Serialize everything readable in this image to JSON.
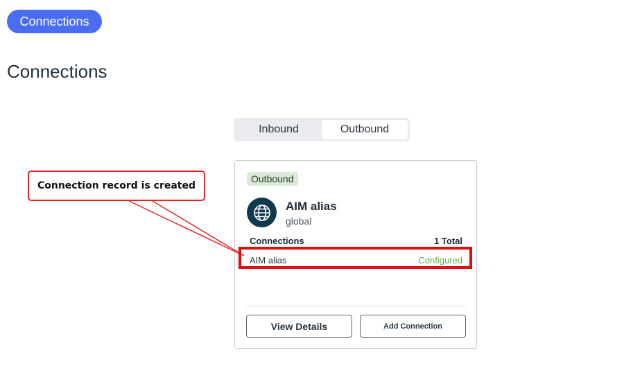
{
  "header": {
    "nav_button_label": "Connections",
    "page_title": "Connections"
  },
  "tabs": [
    {
      "label": "Inbound",
      "active": false
    },
    {
      "label": "Outbound",
      "active": true
    }
  ],
  "card": {
    "badge": "Outbound",
    "icon": "globe-icon",
    "name": "AIM alias",
    "subtitle": "global",
    "connections_heading": "Connections",
    "connections_total": "1 Total",
    "connections": [
      {
        "name": "AIM alias",
        "status": "Configured"
      }
    ],
    "view_details_label": "View Details",
    "add_connection_label": "Add Connection"
  },
  "annotation": {
    "callout_text": "Connection record is created"
  },
  "colors": {
    "accent": "#4a6cf0",
    "badge_bg": "#d9ebd6",
    "status_configured": "#6aa84f",
    "annotation_red": "#e32626",
    "icon_bg": "#0e3a4e"
  }
}
